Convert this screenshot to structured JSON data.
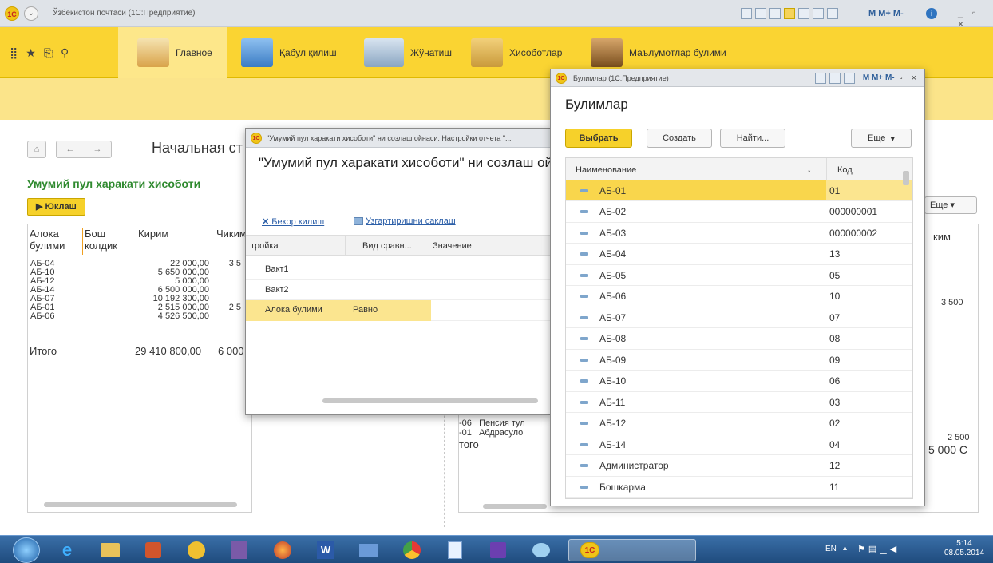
{
  "app": {
    "title": "Ўзбекистон почтаси (1С:Предприятие)",
    "status_icons": "M M+ M-"
  },
  "sections": [
    {
      "label": "Главное",
      "color": "#d9a34a"
    },
    {
      "label": "Қабул қилиш",
      "color": "#3b7cc4"
    },
    {
      "label": "Жўнатиш",
      "color": "#8aa6c2"
    },
    {
      "label": "Хисоботлар",
      "color": "#c99a3b"
    },
    {
      "label": "Маълумотлар булими",
      "color": "#9a6a2e"
    }
  ],
  "nav": {
    "home_icon": "home-icon",
    "back": "←",
    "forward": "→",
    "page_title": "Начальная ст"
  },
  "report": {
    "title": "Умумий пул харакати хисоботи",
    "run_label": "▶ Юклаш",
    "headers": [
      "Алока булими",
      "Бош колдик",
      "Кирим",
      "Чиким"
    ],
    "rows": [
      [
        "АБ-04",
        "",
        "22 000,00",
        "3 5"
      ],
      [
        "АБ-10",
        "",
        "5 650 000,00",
        ""
      ],
      [
        "АБ-12",
        "",
        "5 000,00",
        ""
      ],
      [
        "АБ-14",
        "",
        "6 500 000,00",
        ""
      ],
      [
        "АБ-07",
        "",
        "10 192 300,00",
        ""
      ],
      [
        "АБ-01",
        "",
        "2 515 000,00",
        "2 5"
      ],
      [
        "АБ-06",
        "",
        "4 526 500,00",
        ""
      ]
    ],
    "total_label": "Итого",
    "total_value": "29 410 800,00",
    "total_value2": "6 000"
  },
  "right_report": {
    "more_label": "Еще",
    "col_header": "ким",
    "value1": "3 500",
    "value2": "2 500",
    "value3": "5 000 С",
    "rows": [
      [
        "-06",
        "Пенсия тул"
      ],
      [
        "-01",
        "Абдрасуло"
      ]
    ],
    "total_label": "того"
  },
  "settings_window": {
    "title": "\"Умумий пул харакати хисоботи\" ни созлаш ойнаси: Настройки отчета \"...",
    "heading": "\"Умумий пул харакати хисоботи\" ни созлаш ой",
    "cancel_label": "Бекор килиш",
    "save_label": "Узгартиришни саклаш",
    "headers": [
      "тройка",
      "Вид сравн...",
      "Значение"
    ],
    "rows": [
      {
        "name": "Вакт1",
        "cmp": "",
        "val": ""
      },
      {
        "name": "Вакт2",
        "cmp": "",
        "val": ""
      },
      {
        "name": "Алока булими",
        "cmp": "Равно",
        "val": ""
      }
    ]
  },
  "list_window": {
    "title": "Булимлар (1С:Предприятие)",
    "title_tools": "M M+ M-",
    "heading": "Булимлар",
    "select_label": "Выбрать",
    "create_label": "Создать",
    "find_label": "Найти...",
    "more_label": "Еще",
    "col_name": "Наименование",
    "col_code": "Код",
    "items": [
      {
        "name": "АБ-01",
        "code": "01"
      },
      {
        "name": "АБ-02",
        "code": "000000001"
      },
      {
        "name": "АБ-03",
        "code": "000000002"
      },
      {
        "name": "АБ-04",
        "code": "13"
      },
      {
        "name": "АБ-05",
        "code": "05"
      },
      {
        "name": "АБ-06",
        "code": "10"
      },
      {
        "name": "АБ-07",
        "code": "07"
      },
      {
        "name": "АБ-08",
        "code": "08"
      },
      {
        "name": "АБ-09",
        "code": "09"
      },
      {
        "name": "АБ-10",
        "code": "06"
      },
      {
        "name": "АБ-11",
        "code": "03"
      },
      {
        "name": "АБ-12",
        "code": "02"
      },
      {
        "name": "АБ-14",
        "code": "04"
      },
      {
        "name": "Администратор",
        "code": "12"
      },
      {
        "name": "Бошкарма",
        "code": "11"
      }
    ]
  },
  "taskbar": {
    "lang": "EN",
    "time": "5:14",
    "date": "08.05.2014"
  }
}
